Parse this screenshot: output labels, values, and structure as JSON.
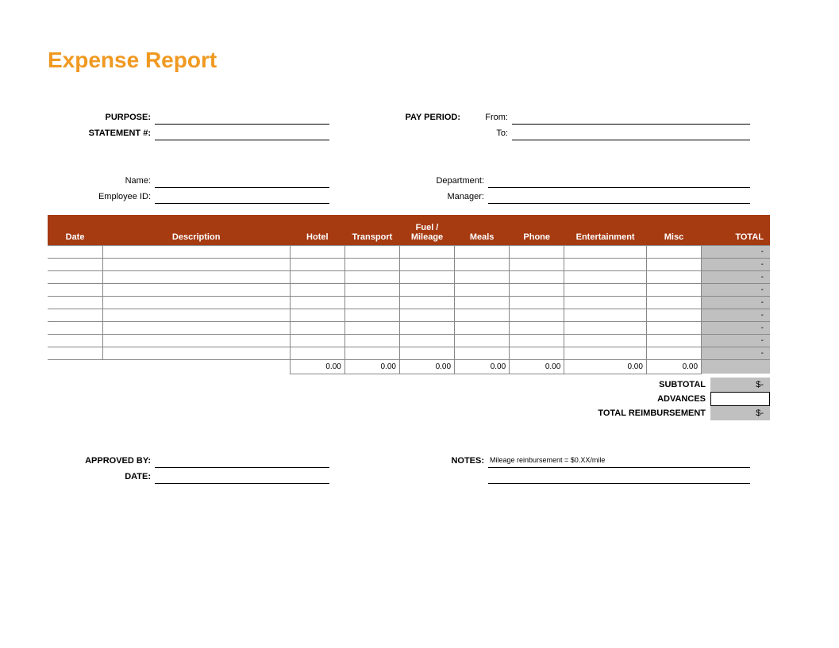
{
  "title": "Expense Report",
  "meta": {
    "purpose_label": "PURPOSE:",
    "statement_label": "STATEMENT #:",
    "pay_period_label": "PAY PERIOD:",
    "from_label": "From:",
    "to_label": "To:",
    "name_label": "Name:",
    "employee_id_label": "Employee ID:",
    "department_label": "Department:",
    "manager_label": "Manager:"
  },
  "columns": {
    "date": "Date",
    "desc": "Description",
    "hotel": "Hotel",
    "transport": "Transport",
    "fuel": "Fuel / Mileage",
    "meals": "Meals",
    "phone": "Phone",
    "ent": "Entertainment",
    "misc": "Misc",
    "total": "TOTAL"
  },
  "row_total_placeholder": "-",
  "col_sum": "0.00",
  "summary": {
    "subtotal_label": "SUBTOTAL",
    "subtotal_value": "$-",
    "advances_label": "ADVANCES",
    "advances_value": "",
    "reimb_label": "TOTAL REIMBURSEMENT",
    "reimb_value": "$-"
  },
  "footer": {
    "approved_label": "APPROVED BY:",
    "date_label": "DATE:",
    "notes_label": "NOTES:",
    "notes_value": "Mileage reinbursement = $0.XX/mile"
  }
}
